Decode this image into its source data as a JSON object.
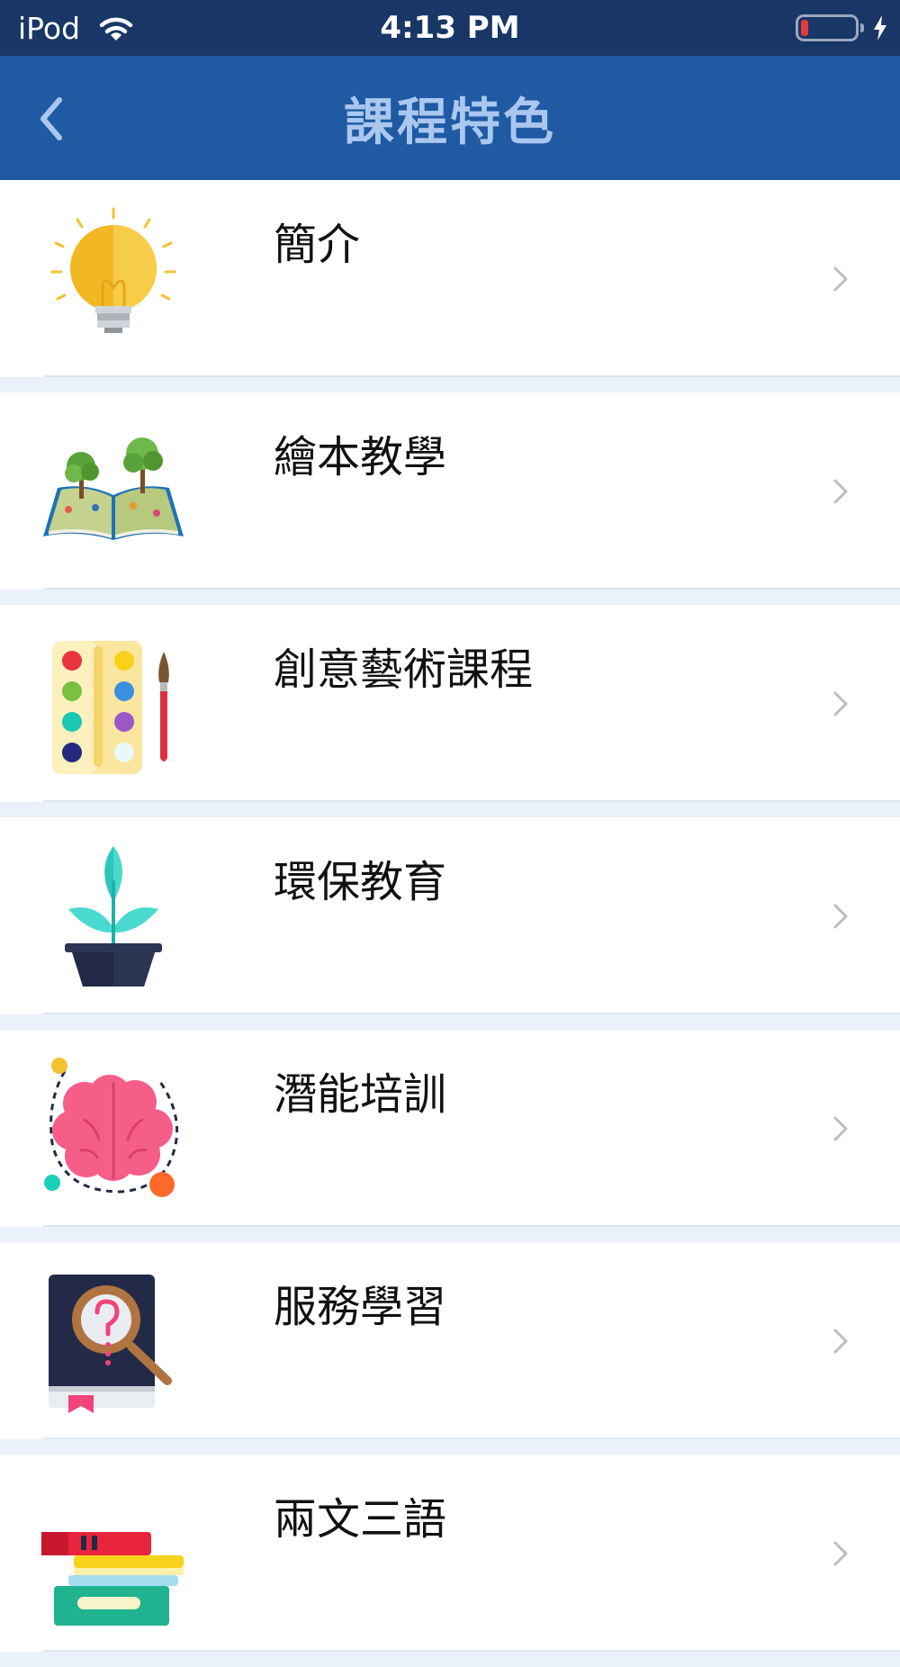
{
  "status_bar": {
    "carrier": "iPod",
    "time": "4:13 PM",
    "battery_level": 0.1,
    "icons": [
      "wifi-icon",
      "battery-icon",
      "charging-bolt-icon"
    ]
  },
  "nav": {
    "title": "課程特色",
    "back_icon": "chevron-left-icon"
  },
  "items": [
    {
      "label": "簡介",
      "icon": "lightbulb-icon"
    },
    {
      "label": "繪本教學",
      "icon": "picture-book-icon"
    },
    {
      "label": "創意藝術課程",
      "icon": "paint-palette-icon"
    },
    {
      "label": "環保教育",
      "icon": "plant-pot-icon"
    },
    {
      "label": "潛能培訓",
      "icon": "brain-icon"
    },
    {
      "label": "服務學習",
      "icon": "magnifier-book-icon"
    },
    {
      "label": "兩文三語",
      "icon": "book-stack-icon"
    }
  ],
  "colors": {
    "status_bar": "#183766",
    "nav_bar": "#1f5aa3",
    "nav_title": "#a9c7ef",
    "page_background": "#eaf1fb"
  }
}
